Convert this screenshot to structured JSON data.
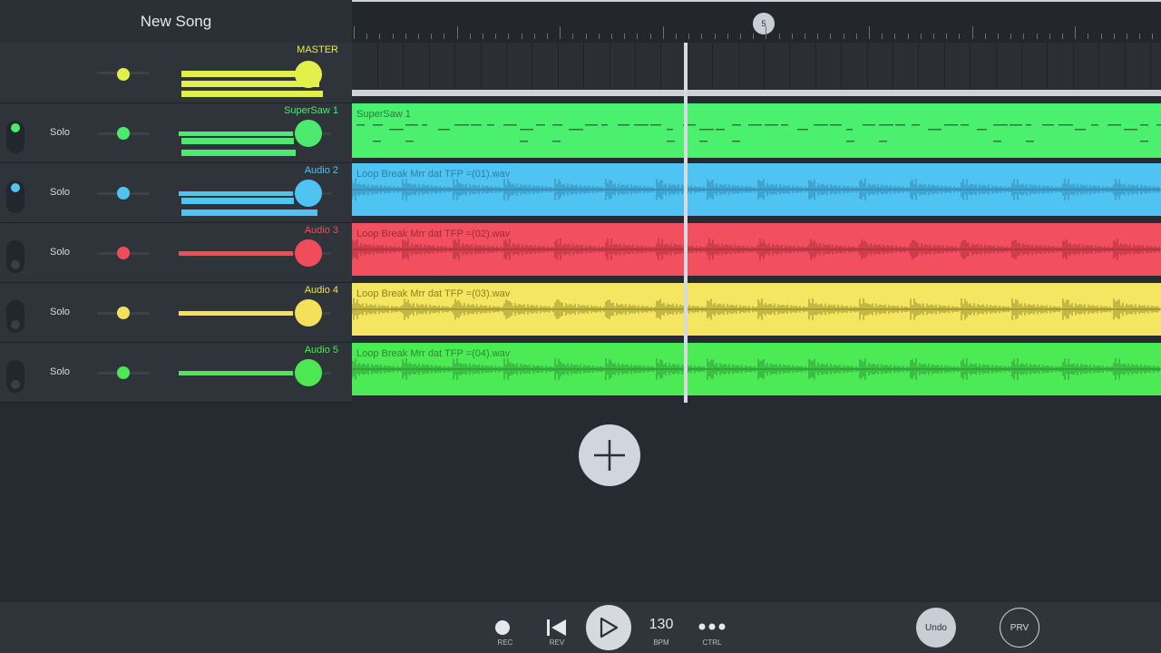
{
  "song": {
    "title": "New Song"
  },
  "ruler": {
    "marker_label": "5"
  },
  "master": {
    "name": "MASTER",
    "color": "#e4f04a"
  },
  "tracks": [
    {
      "name": "SuperSaw 1",
      "solo_label": "Solo",
      "color": "#4cea6e",
      "mute_on": true,
      "clip": {
        "label": "SuperSaw 1",
        "kind": "pattern",
        "bg": "#4cf06f",
        "label_color": "#2a7a3f"
      }
    },
    {
      "name": "Audio 2",
      "solo_label": "Solo",
      "color": "#4fc4f2",
      "mute_on": true,
      "clip": {
        "label": "Loop Break Mrr dat TFP =(01).wav",
        "kind": "audio",
        "bg": "#4fc4f2",
        "label_color": "#2d7fa6"
      }
    },
    {
      "name": "Audio 3",
      "solo_label": "Solo",
      "color": "#f04c5c",
      "mute_on": false,
      "clip": {
        "label": "Loop Break Mrr dat TFP =(02).wav",
        "kind": "audio",
        "bg": "#f2505e",
        "label_color": "#9e2a35"
      }
    },
    {
      "name": "Audio 4",
      "solo_label": "Solo",
      "color": "#f4e05a",
      "mute_on": false,
      "clip": {
        "label": "Loop Break Mrr dat TFP =(03).wav",
        "kind": "audio",
        "bg": "#f4e660",
        "label_color": "#8a8024"
      }
    },
    {
      "name": "Audio 5",
      "solo_label": "Solo",
      "color": "#4ce854",
      "mute_on": false,
      "clip": {
        "label": "Loop Break Mrr dat TFP =(04).wav",
        "kind": "audio",
        "bg": "#4ceb55",
        "label_color": "#2a8a32"
      }
    }
  ],
  "transport": {
    "rec_label": "REC",
    "rev_label": "REV",
    "bpm_value": "130",
    "bpm_label": "BPM",
    "ctrl_label": "CTRL",
    "undo_label": "Undo",
    "prv_label": "PRV"
  },
  "icons": {
    "add": "plus-icon",
    "rec": "record-icon",
    "rev": "skip-back-icon",
    "play": "play-icon",
    "ctrl": "more-icon"
  }
}
